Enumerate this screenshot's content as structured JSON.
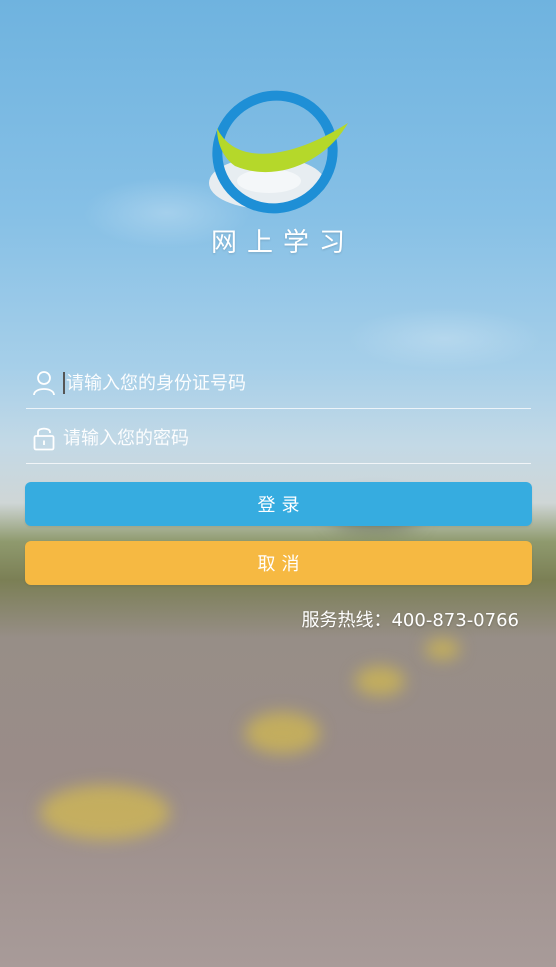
{
  "app": {
    "title": "网上学习"
  },
  "login_form": {
    "id_field": {
      "placeholder": "请输入您的身份证号码",
      "value": ""
    },
    "password_field": {
      "placeholder": "请输入您的密码",
      "value": ""
    },
    "login_label": "登录",
    "cancel_label": "取消"
  },
  "footer": {
    "hotline": "服务热线：400-873-0766"
  },
  "icons": {
    "user": "user-icon",
    "lock": "lock-icon",
    "logo": "app-logo"
  },
  "colors": {
    "login_button": "#36ace0",
    "cancel_button": "#f6b942",
    "logo_blue": "#1e8fd6",
    "logo_green": "#b5d82a"
  }
}
